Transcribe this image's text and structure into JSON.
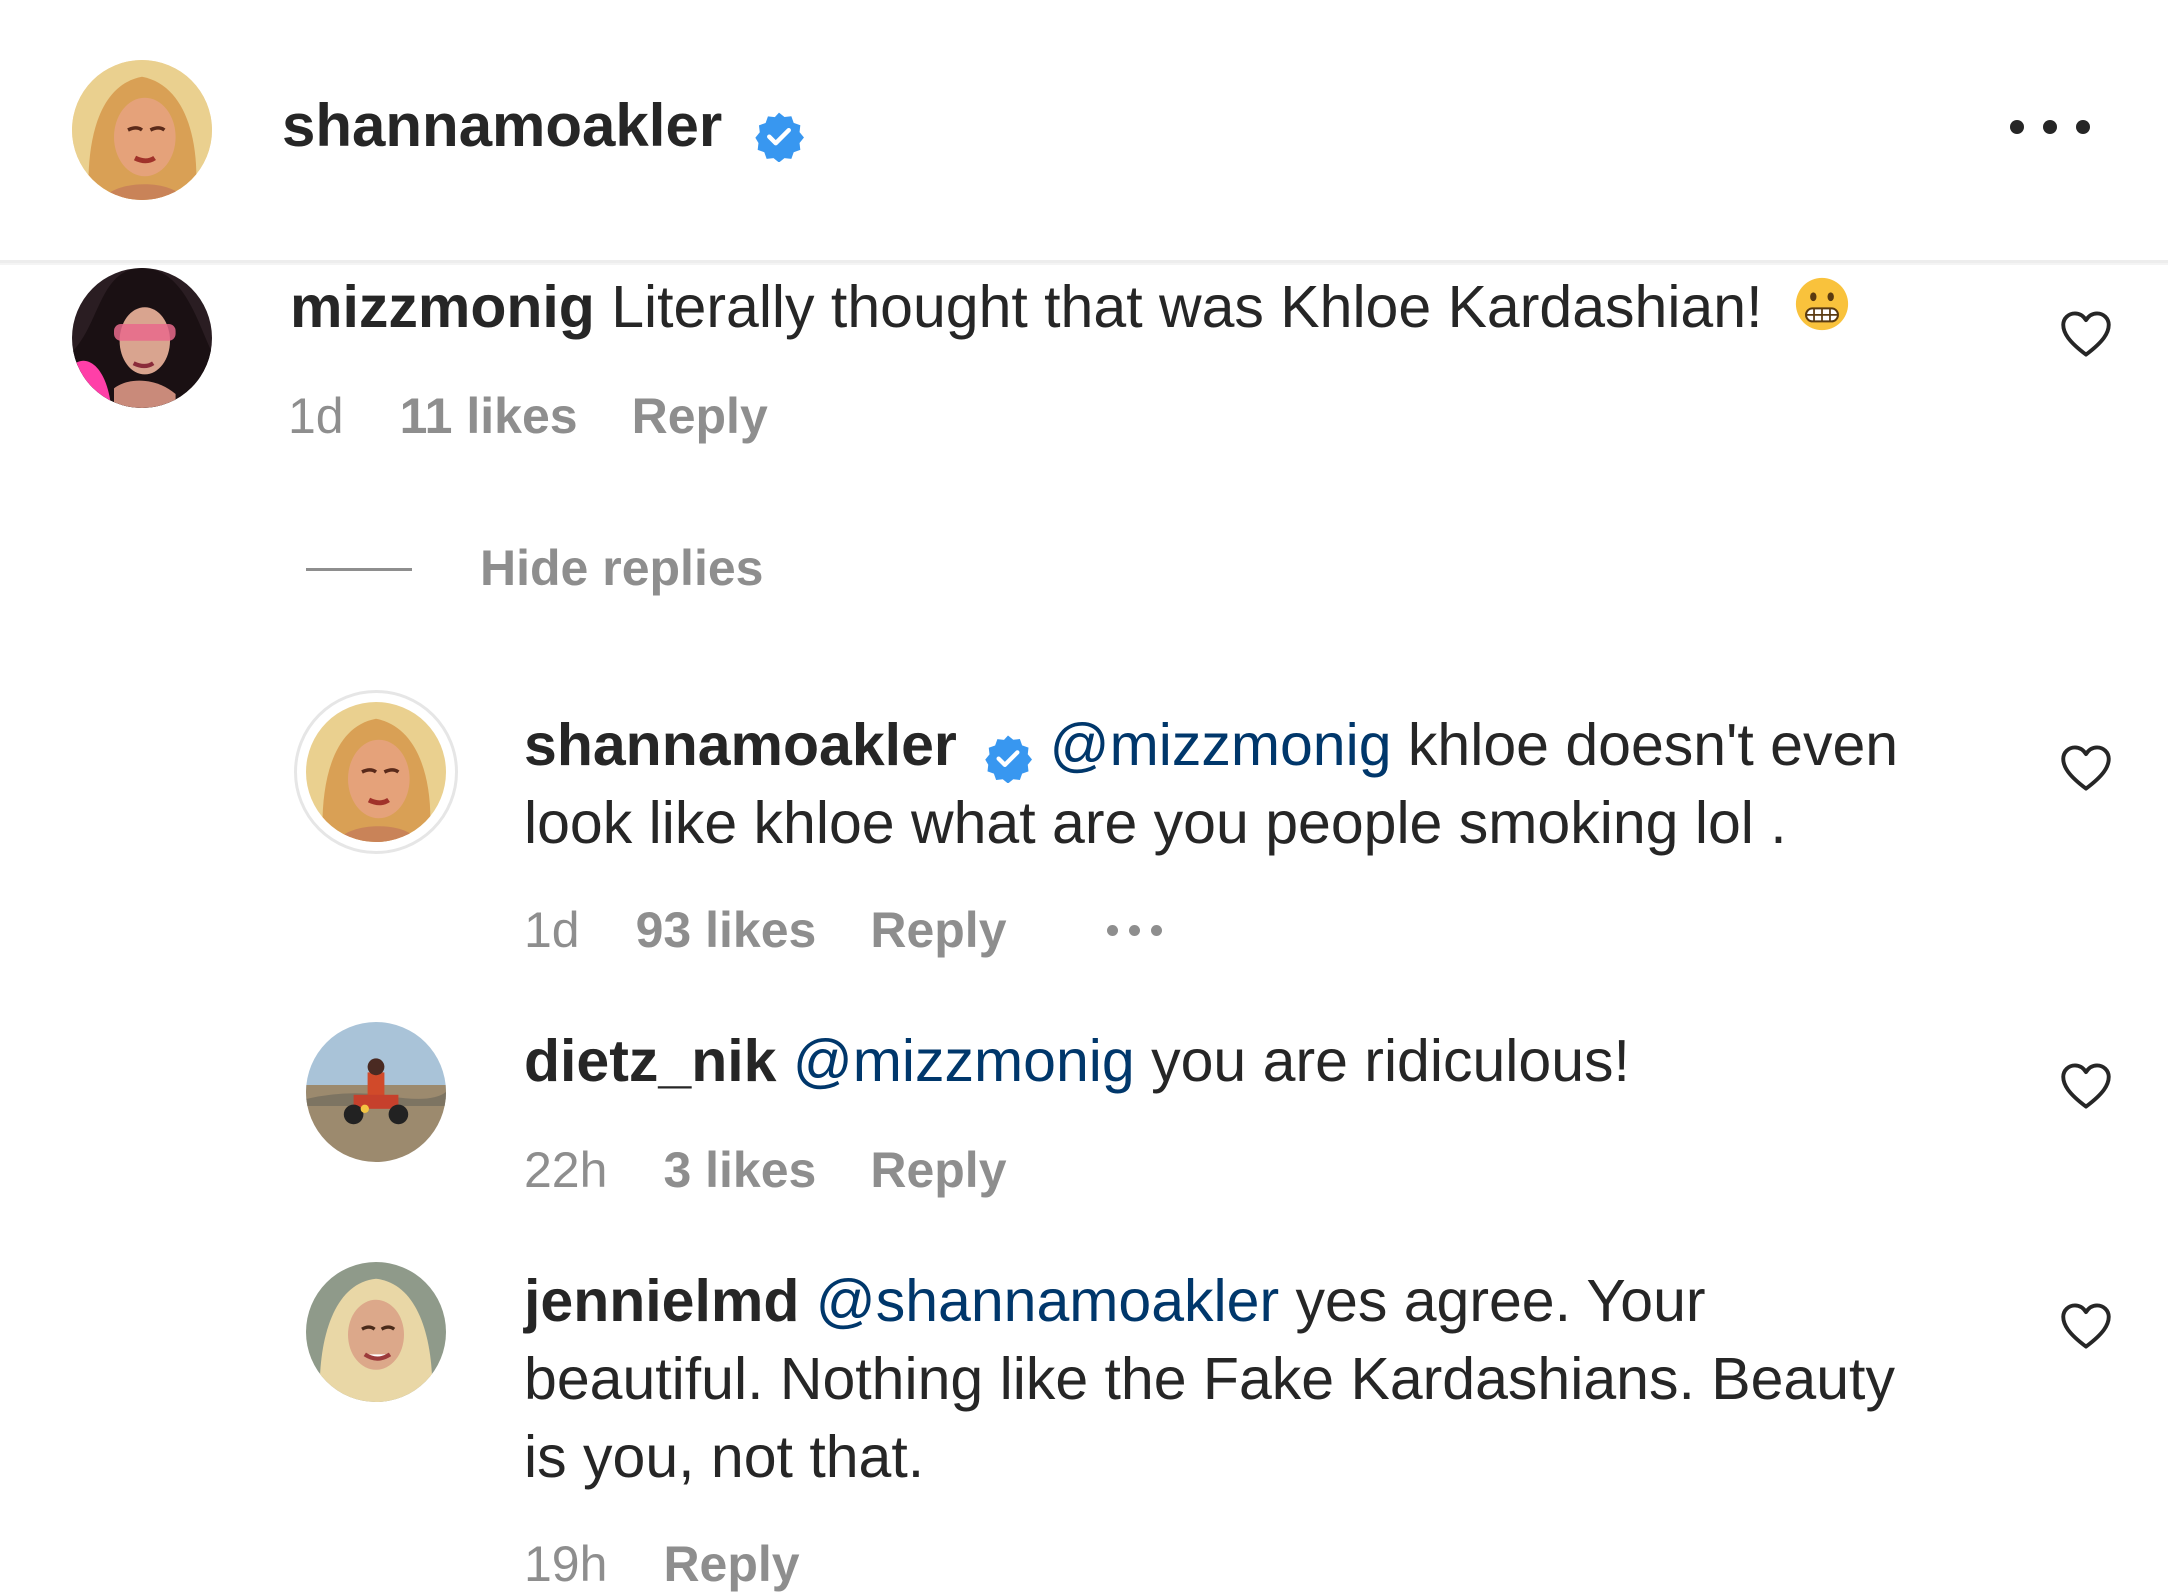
{
  "header": {
    "username": "shannamoakler",
    "verified": true
  },
  "comments": [
    {
      "username": "mizzmonig",
      "text": "Literally thought that was Khloe Kardashian!",
      "emoji": "grimacing-face",
      "time": "1d",
      "likes": "11 likes",
      "reply_label": "Reply"
    }
  ],
  "hide_replies_label": "Hide replies",
  "replies": [
    {
      "username": "shannamoakler",
      "verified": true,
      "mention": "@mizzmonig",
      "text_line1": "khloe doesn't even",
      "text_line2": "look like khloe what are you people smoking lol .",
      "time": "1d",
      "likes": "93 likes",
      "reply_label": "Reply"
    },
    {
      "username": "dietz_nik",
      "mention": "@mizzmonig",
      "text": "you are ridiculous!",
      "time": "22h",
      "likes": "3 likes",
      "reply_label": "Reply"
    },
    {
      "username": "jennielmd",
      "mention": "@shannamoakler",
      "text_line1": "yes agree. Your",
      "text_line2": "beautiful. Nothing like the Fake Kardashians. Beauty",
      "text_line3": "is you, not that.",
      "time": "19h",
      "reply_label": "Reply"
    }
  ],
  "colors": {
    "text": "#262626",
    "secondary": "#8e8e8e",
    "mention": "#00376b",
    "verified": "#3897f0"
  }
}
